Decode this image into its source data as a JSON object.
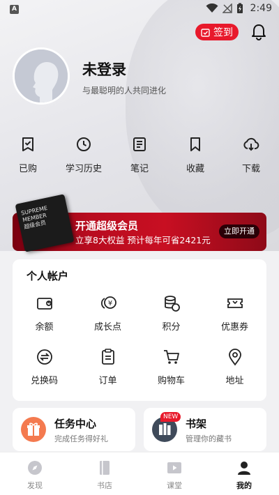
{
  "status_bar": {
    "app_badge": "A",
    "time": "2:49"
  },
  "header": {
    "checkin_label": "签到",
    "checkin_color": "#e8192b",
    "bell_icon": "bell-icon"
  },
  "profile": {
    "username": "未登录",
    "tagline": "与最聪明的人共同进化",
    "avatar_icon": "default-avatar-silhouette"
  },
  "quick_actions": [
    {
      "label": "已购",
      "icon": "purchased-icon"
    },
    {
      "label": "学习历史",
      "icon": "history-clock-icon"
    },
    {
      "label": "笔记",
      "icon": "notes-icon"
    },
    {
      "label": "收藏",
      "icon": "bookmark-icon"
    },
    {
      "label": "下载",
      "icon": "cloud-download-icon"
    }
  ],
  "vip_banner": {
    "card_lines": [
      "SUPREME",
      "MEMBER",
      "超级会员"
    ],
    "title": "开通超级会员",
    "subtitle": "立享8大权益 预计每年可省2421元",
    "button": "立即开通",
    "color": "#c80f22"
  },
  "account": {
    "title": "个人帐户",
    "items": [
      {
        "label": "余额",
        "icon": "wallet-icon"
      },
      {
        "label": "成长点",
        "icon": "coins-icon"
      },
      {
        "label": "积分",
        "icon": "points-stack-icon"
      },
      {
        "label": "优惠券",
        "icon": "coupon-icon"
      },
      {
        "label": "兑换码",
        "icon": "exchange-code-icon"
      },
      {
        "label": "订单",
        "icon": "order-list-icon"
      },
      {
        "label": "购物车",
        "icon": "cart-icon"
      },
      {
        "label": "地址",
        "icon": "location-pin-icon"
      }
    ]
  },
  "cards": {
    "tasks": {
      "title": "任务中心",
      "subtitle": "完成任务得好礼",
      "icon": "gift-icon",
      "color": "#f47a4f"
    },
    "bookshelf": {
      "title": "书架",
      "subtitle": "管理你的藏书",
      "badge": "NEW",
      "icon": "bookshelf-icon",
      "color": "#3f4a5a"
    }
  },
  "bottom_nav": [
    {
      "label": "发现",
      "icon": "compass-icon",
      "active": false
    },
    {
      "label": "书店",
      "icon": "book-icon",
      "active": false
    },
    {
      "label": "课堂",
      "icon": "video-play-icon",
      "active": false
    },
    {
      "label": "我的",
      "icon": "person-icon",
      "active": true
    }
  ]
}
